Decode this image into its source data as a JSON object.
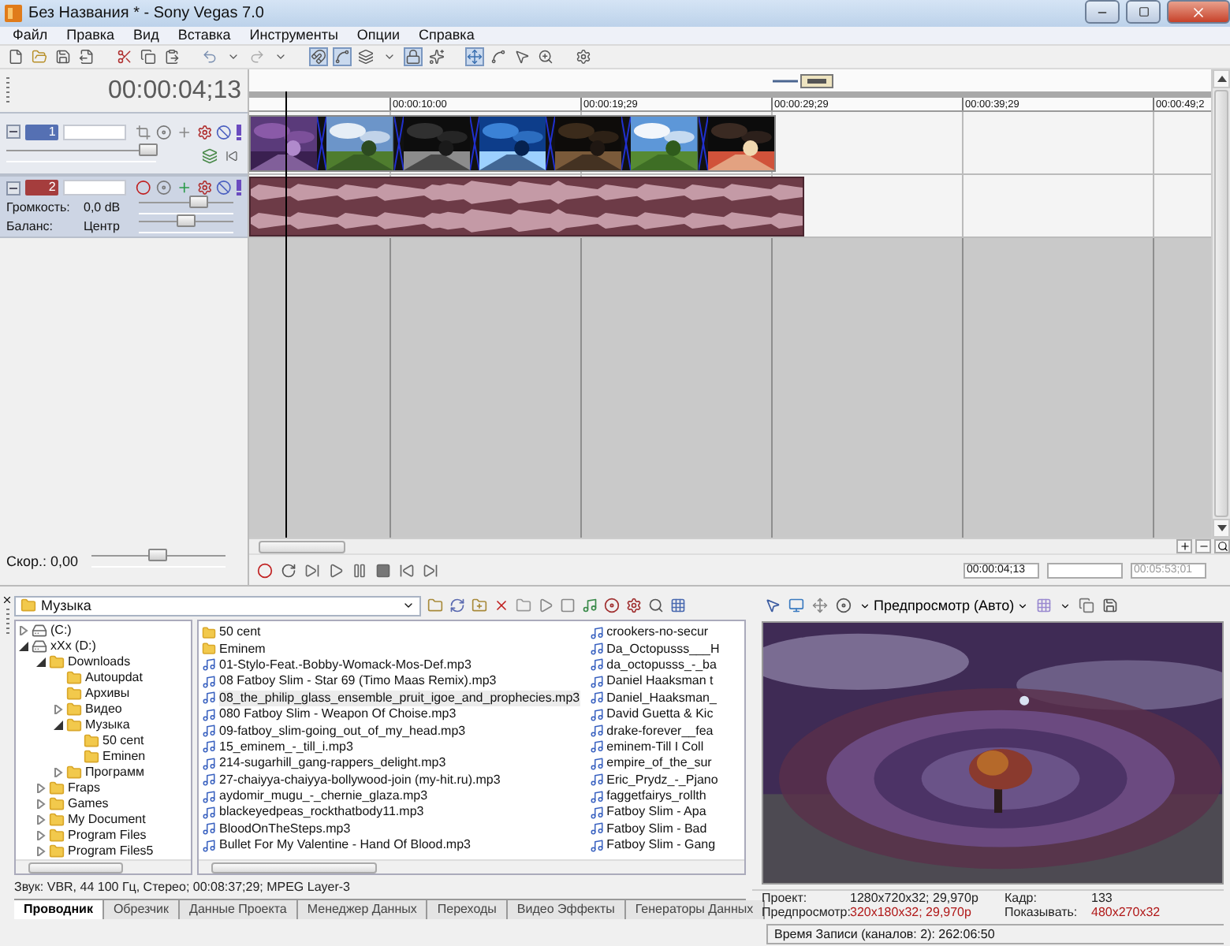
{
  "window": {
    "title": "Без Названия * - Sony Vegas 7.0"
  },
  "menu": [
    "Файл",
    "Правка",
    "Вид",
    "Вставка",
    "Инструменты",
    "Опции",
    "Справка"
  ],
  "timeline": {
    "time": "00:00:04;13",
    "ruler": [
      "00:00:10:00",
      "00:00:19;29",
      "00:00:29;29",
      "00:00:39;29",
      "00:00:49;2"
    ],
    "tracks": [
      {
        "kind": "video",
        "number": "1",
        "selected": false,
        "level": 0.95,
        "clips": [
          {
            "kind": "picture"
          },
          {
            "kind": "picture"
          },
          {
            "kind": "picture"
          },
          {
            "kind": "picture"
          },
          {
            "kind": "picture"
          },
          {
            "kind": "picture"
          },
          {
            "kind": "picture"
          }
        ]
      },
      {
        "kind": "audio",
        "number": "2",
        "selected": true,
        "volume": {
          "label": "Громкость:",
          "value": "0,0 dB",
          "level": 0.63
        },
        "balance": {
          "label": "Баланс:",
          "value": "Центр",
          "level": 0.5
        }
      }
    ],
    "rate": {
      "label": "Скор.: 0,00",
      "level": 0.5
    }
  },
  "transport": {
    "cursor": "00:00:04;13",
    "length": "00:05:53;01"
  },
  "explorer": {
    "path": "Музыка",
    "tree": [
      {
        "label": "(C:)",
        "kind": "drive",
        "expanded": false
      },
      {
        "label": "xXx (D:)",
        "kind": "drive",
        "expanded": true,
        "children": [
          {
            "label": "Downloads",
            "kind": "folder",
            "expanded": true,
            "children": [
              {
                "label": "Autoupdat",
                "kind": "folder"
              },
              {
                "label": "Архивы",
                "kind": "folder"
              },
              {
                "label": "Видео",
                "kind": "folder",
                "expanded": false
              },
              {
                "label": "Музыка",
                "kind": "folder",
                "expanded": true,
                "children": [
                  {
                    "label": "50 cent",
                    "kind": "folder"
                  },
                  {
                    "label": "Eminen",
                    "kind": "folder"
                  }
                ]
              },
              {
                "label": "Программ",
                "kind": "folder",
                "expanded": false
              }
            ]
          },
          {
            "label": "Fraps",
            "kind": "folder",
            "expanded": false
          },
          {
            "label": "Games",
            "kind": "folder",
            "expanded": false
          },
          {
            "label": "My Document",
            "kind": "folder",
            "expanded": false
          },
          {
            "label": "Program Files",
            "kind": "folder",
            "expanded": false
          },
          {
            "label": "Program Files5",
            "kind": "folder",
            "expanded": false
          }
        ]
      }
    ],
    "file_columns": [
      {
        "items": [
          {
            "name": "50 cent",
            "kind": "folder",
            "selected": false
          },
          {
            "name": "Eminem",
            "kind": "folder",
            "selected": false
          },
          {
            "name": "01-Stylo-Feat.-Bobby-Womack-Mos-Def.mp3",
            "kind": "audio",
            "selected": false
          },
          {
            "name": "08 Fatboy Slim - Star 69 (Timo Maas Remix).mp3",
            "kind": "audio",
            "selected": false
          },
          {
            "name": "08_the_philip_glass_ensemble_pruit_igoe_and_prophecies.mp3",
            "kind": "audio",
            "selected": true
          },
          {
            "name": "080 Fatboy Slim - Weapon Of Choise.mp3",
            "kind": "audio",
            "selected": false
          },
          {
            "name": "09-fatboy_slim-going_out_of_my_head.mp3",
            "kind": "audio",
            "selected": false
          },
          {
            "name": "15_eminem_-_till_i.mp3",
            "kind": "audio",
            "selected": false
          },
          {
            "name": "214-sugarhill_gang-rappers_delight.mp3",
            "kind": "audio",
            "selected": false
          },
          {
            "name": "27-chaiyya-chaiyya-bollywood-join (my-hit.ru).mp3",
            "kind": "audio",
            "selected": false
          },
          {
            "name": "aydomir_mugu_-_chernie_glaza.mp3",
            "kind": "audio",
            "selected": false
          },
          {
            "name": "blackeyedpeas_rockthatbody11.mp3",
            "kind": "audio",
            "selected": false
          },
          {
            "name": "BloodOnTheSteps.mp3",
            "kind": "audio",
            "selected": false
          },
          {
            "name": "Bullet For My Valentine - Hand Of Blood.mp3",
            "kind": "audio",
            "selected": false
          }
        ]
      },
      {
        "items": [
          {
            "name": "crookers-no-secur",
            "kind": "audio",
            "selected": false
          },
          {
            "name": "Da_Octopusss___H",
            "kind": "audio",
            "selected": false
          },
          {
            "name": "da_octopusss_-_ba",
            "kind": "audio",
            "selected": false
          },
          {
            "name": "Daniel Haaksman t",
            "kind": "audio",
            "selected": false
          },
          {
            "name": "Daniel_Haaksman_",
            "kind": "audio",
            "selected": false
          },
          {
            "name": "David Guetta & Kic",
            "kind": "audio",
            "selected": false
          },
          {
            "name": "drake-forever__fea",
            "kind": "audio",
            "selected": false
          },
          {
            "name": "eminem-Till I Coll",
            "kind": "audio",
            "selected": false
          },
          {
            "name": "empire_of_the_sur",
            "kind": "audio",
            "selected": false
          },
          {
            "name": "Eric_Prydz_-_Pjano",
            "kind": "audio",
            "selected": false
          },
          {
            "name": "faggetfairys_rollth",
            "kind": "audio",
            "selected": false
          },
          {
            "name": "Fatboy Slim - Apa",
            "kind": "audio",
            "selected": false
          },
          {
            "name": "Fatboy Slim - Bad",
            "kind": "audio",
            "selected": false
          },
          {
            "name": "Fatboy Slim - Gang",
            "kind": "audio",
            "selected": false
          }
        ]
      }
    ],
    "status": "Звук: VBR, 44 100 Гц, Стерео; 00:08:37;29; MPEG Layer-3",
    "tabs": [
      {
        "label": "Проводник",
        "selected": true
      },
      {
        "label": "Обрезчик",
        "selected": false
      },
      {
        "label": "Данные Проекта",
        "selected": false
      },
      {
        "label": "Менеджер Данных",
        "selected": false
      },
      {
        "label": "Переходы",
        "selected": false
      },
      {
        "label": "Видео Эффекты",
        "selected": false
      },
      {
        "label": "Генераторы Данных",
        "selected": false
      }
    ]
  },
  "preview": {
    "mode": "Предпросмотр (Авто)",
    "picture": {
      "kind": "picture"
    },
    "info": [
      {
        "label": "Проект:",
        "value": "1280x720x32; 29,970p",
        "changed": false
      },
      {
        "label": "Кадр:",
        "value": "133",
        "changed": false
      },
      {
        "label": "Предпросмотр:",
        "value": "320x180x32; 29,970p",
        "changed": true
      },
      {
        "label": "Показывать:",
        "value": "480x270x32",
        "changed": true
      }
    ],
    "status": "Время Записи (каналов: 2): 262:06:50"
  }
}
